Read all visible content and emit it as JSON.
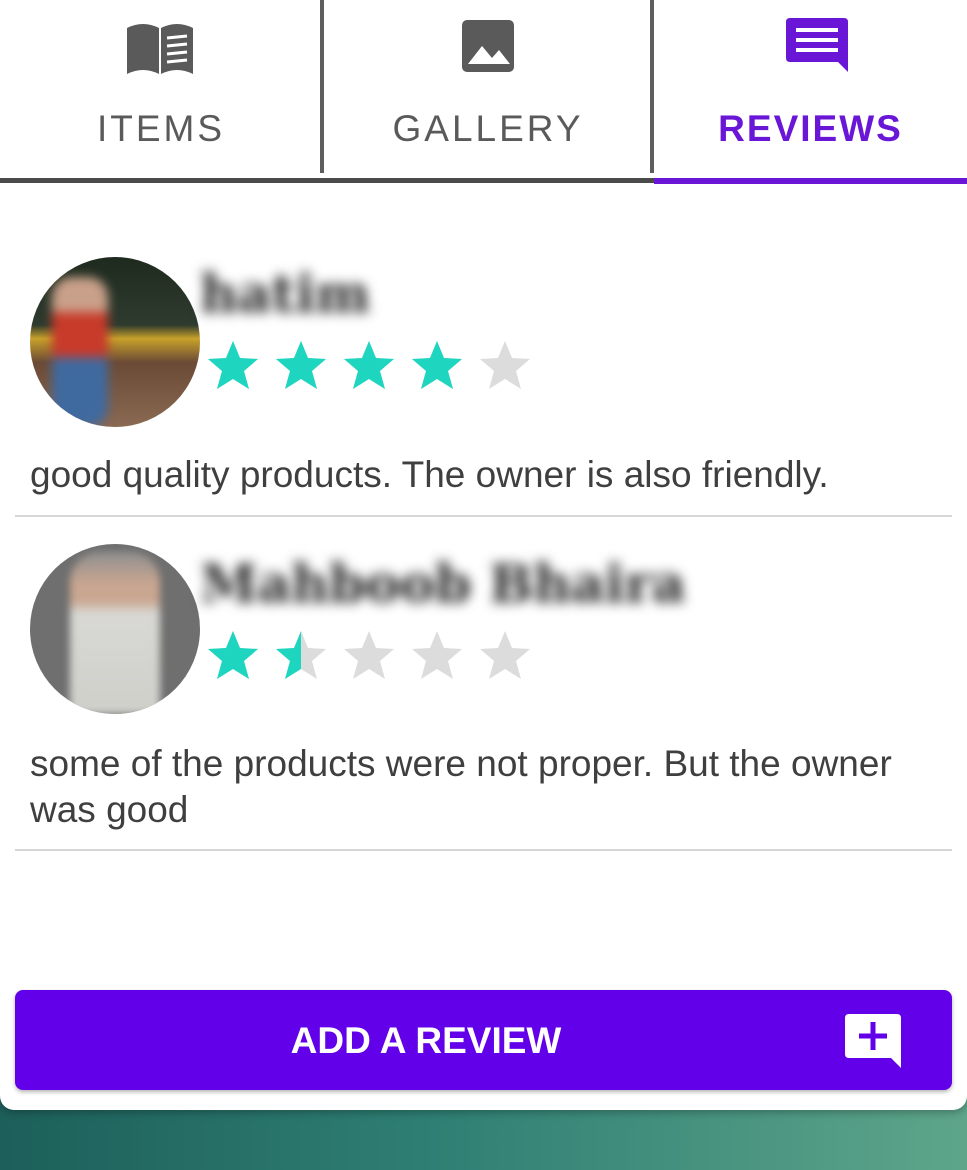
{
  "tabs": [
    {
      "label": "ITEMS",
      "icon": "book-icon",
      "active": false
    },
    {
      "label": "GALLERY",
      "icon": "image-icon",
      "active": false
    },
    {
      "label": "REVIEWS",
      "icon": "comment-icon",
      "active": true
    }
  ],
  "colors": {
    "accent": "#6a16d6",
    "button": "#6200ea",
    "star_filled": "#1ed6c0",
    "star_empty": "#dcdcdc"
  },
  "reviews": [
    {
      "name": "hatim",
      "rating": 4,
      "max_rating": 5,
      "text": "good quality products. The owner is also friendly."
    },
    {
      "name": "Mahboob Bhaira",
      "rating": 1.5,
      "max_rating": 5,
      "text": "some of the products were not proper. But the owner was good"
    }
  ],
  "add_review": {
    "label": "ADD A REVIEW",
    "icon": "add-comment-icon"
  }
}
